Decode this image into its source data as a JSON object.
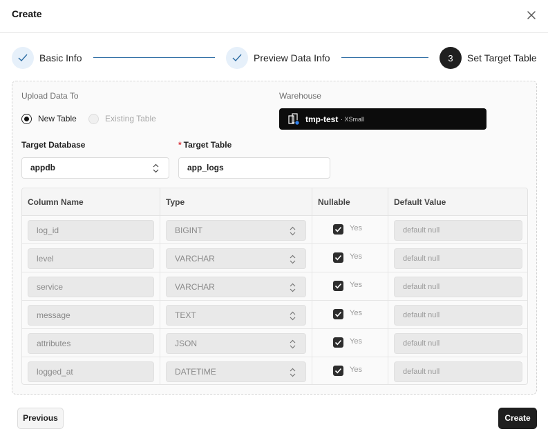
{
  "dialog": {
    "title": "Create"
  },
  "steps": [
    {
      "label": "Basic Info",
      "status": "done"
    },
    {
      "label": "Preview Data Info",
      "status": "done"
    },
    {
      "label": "Set Target Table",
      "status": "active",
      "number": "3"
    }
  ],
  "upload": {
    "label": "Upload Data To",
    "options": [
      {
        "label": "New Table",
        "selected": true
      },
      {
        "label": "Existing Table",
        "selected": false
      }
    ]
  },
  "warehouse": {
    "label": "Warehouse",
    "name": "tmp-test",
    "size": "· XSmall"
  },
  "target_database": {
    "label": "Target Database",
    "value": "appdb"
  },
  "target_table": {
    "required_mark": "*",
    "label": "Target Table",
    "value": "app_logs"
  },
  "table": {
    "headers": [
      "Column Name",
      "Type",
      "Nullable",
      "Default Value"
    ],
    "rows": [
      {
        "name": "log_id",
        "type": "BIGINT",
        "nullable": "Yes",
        "default": "default null"
      },
      {
        "name": "level",
        "type": "VARCHAR",
        "nullable": "Yes",
        "default": "default null"
      },
      {
        "name": "service",
        "type": "VARCHAR",
        "nullable": "Yes",
        "default": "default null"
      },
      {
        "name": "message",
        "type": "TEXT",
        "nullable": "Yes",
        "default": "default null"
      },
      {
        "name": "attributes",
        "type": "JSON",
        "nullable": "Yes",
        "default": "default null"
      },
      {
        "name": "logged_at",
        "type": "DATETIME",
        "nullable": "Yes",
        "default": "default null"
      }
    ]
  },
  "footer": {
    "previous_label": "Previous",
    "create_label": "Create"
  },
  "colors": {
    "accent": "#2c6ca3",
    "step_done_bg": "#e6f0fa",
    "primary": "#1f1f1f",
    "required": "#d9363e"
  }
}
